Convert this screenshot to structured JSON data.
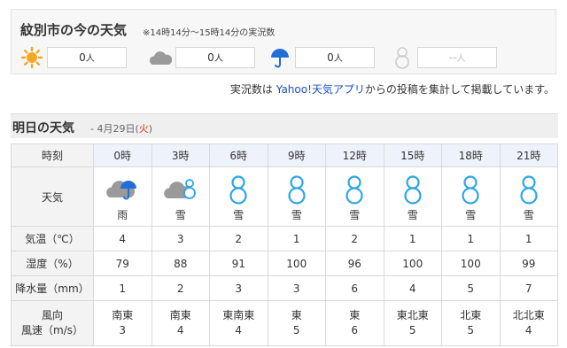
{
  "now": {
    "title": "紋別市の今の天気",
    "subtitle": "※14時14分～15時14分の実況数",
    "reports": [
      {
        "icon": "sun-icon",
        "count": "0",
        "unit": "人"
      },
      {
        "icon": "cloud-icon",
        "count": "0",
        "unit": "人"
      },
      {
        "icon": "umbrella-icon",
        "count": "0",
        "unit": "人"
      },
      {
        "icon": "snowman-icon",
        "count": "--",
        "unit": "人"
      }
    ],
    "note_prefix": "実況数は",
    "note_link": "Yahoo!天気アプリ",
    "note_suffix": "からの投稿を集計して掲載しています。"
  },
  "forecast": {
    "title": "明日の天気",
    "date_prefix": "- 4月29日(",
    "dow": "火",
    "date_suffix": ")",
    "row_labels": {
      "time": "時刻",
      "weather": "天気",
      "temp": "気温（℃）",
      "humidity": "湿度（%）",
      "precip": "降水量（mm）",
      "wind_dir": "風向",
      "wind_speed": "風速（m/s）"
    },
    "hours": [
      "0時",
      "3時",
      "6時",
      "9時",
      "12時",
      "15時",
      "18時",
      "21時"
    ],
    "weather": [
      {
        "icon": "rain-cloud-icon",
        "text": "雨"
      },
      {
        "icon": "snow-cloud-icon",
        "text": "雪"
      },
      {
        "icon": "snowman-icon",
        "text": "雪"
      },
      {
        "icon": "snowman-icon",
        "text": "雪"
      },
      {
        "icon": "snowman-icon",
        "text": "雪"
      },
      {
        "icon": "snowman-icon",
        "text": "雪"
      },
      {
        "icon": "snowman-icon",
        "text": "雪"
      },
      {
        "icon": "snowman-icon",
        "text": "雪"
      }
    ],
    "temp": [
      "4",
      "3",
      "2",
      "1",
      "2",
      "1",
      "1",
      "1"
    ],
    "humidity": [
      "79",
      "88",
      "91",
      "100",
      "96",
      "100",
      "100",
      "99"
    ],
    "precip": [
      "1",
      "2",
      "3",
      "3",
      "6",
      "4",
      "5",
      "7"
    ],
    "wind_dir": [
      "南東",
      "南東",
      "東南東",
      "東",
      "東",
      "東北東",
      "北東",
      "北北東"
    ],
    "wind_speed": [
      "3",
      "4",
      "4",
      "5",
      "6",
      "5",
      "5",
      "4"
    ]
  },
  "colors": {
    "sun": "#f5a623",
    "cloud": "#9a9a9a",
    "umbrella": "#1f6fd6",
    "snowman": "#2aa6e8",
    "header_bg": "#eef2fa"
  }
}
